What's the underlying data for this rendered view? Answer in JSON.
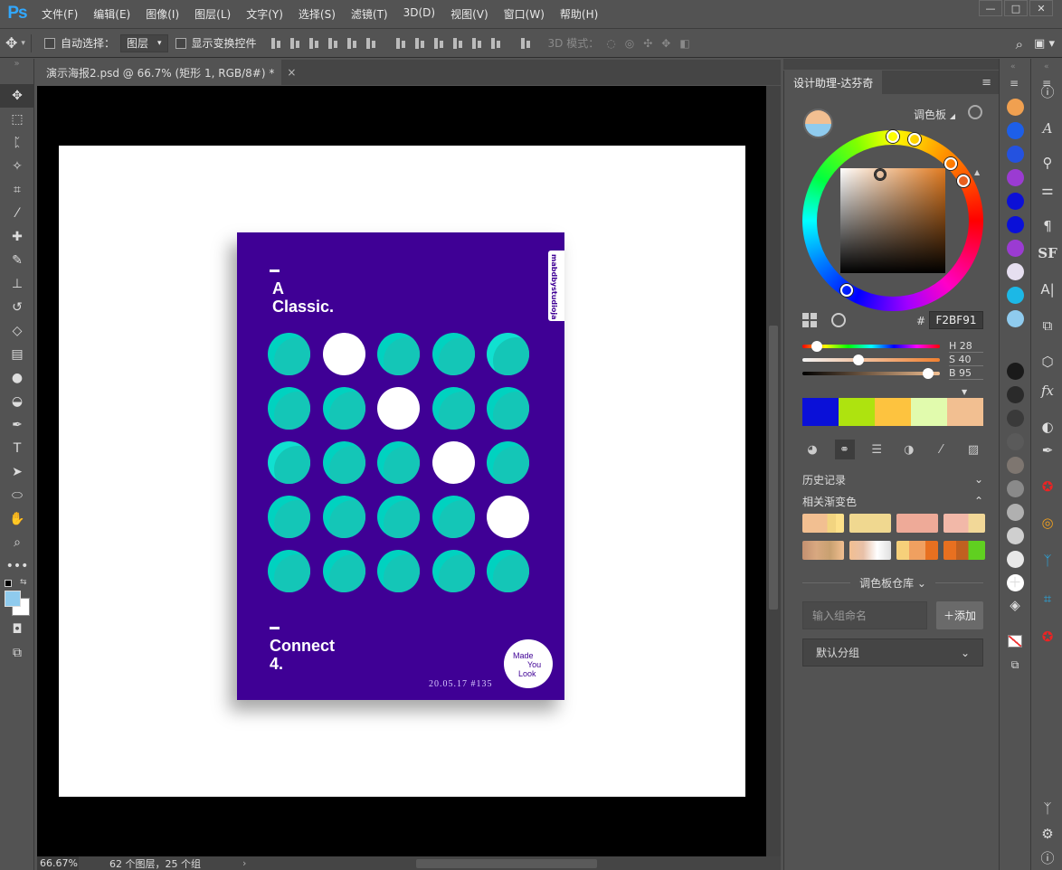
{
  "app": {
    "logo": "Ps",
    "window_controls": [
      "—",
      "□",
      "✕"
    ]
  },
  "menu": [
    "文件(F)",
    "编辑(E)",
    "图像(I)",
    "图层(L)",
    "文字(Y)",
    "选择(S)",
    "滤镜(T)",
    "3D(D)",
    "视图(V)",
    "窗口(W)",
    "帮助(H)"
  ],
  "options": {
    "auto_select_label": "自动选择：",
    "auto_select_value": "图层",
    "show_transform_label": "显示变换控件",
    "mode_3d_label": "3D 模式："
  },
  "document": {
    "tab_title": "演示海报2.psd @ 66.7% (矩形 1, RGB/8#) *",
    "close": "×"
  },
  "poster": {
    "title_line1": "A",
    "title_line2": "Classic.",
    "side_tab": "mabdbystudioja",
    "subtitle_line1": "Connect",
    "subtitle_line2": "4.",
    "date": "20.05.17   #135",
    "badge": [
      "Made",
      "You",
      "Look"
    ]
  },
  "status": {
    "zoom": "66.67%",
    "info": "62 个图层，25 个组",
    "arrow": "›"
  },
  "panel": {
    "tab": "设计助理-达芬奇",
    "palette_label": "调色板",
    "hex_hash": "#",
    "hex_value": "F2BF91",
    "h_label": "H",
    "h_value": "28",
    "s_label": "S",
    "s_value": "40",
    "b_label": "B",
    "b_value": "95",
    "colorbar": [
      "#0a10d8",
      "#aee30f",
      "#fdc33f",
      "#e1fbad",
      "#f2bf91"
    ],
    "history_label": "历史记录",
    "gradients_label": "相关渐变色",
    "library_label": "调色板仓库",
    "group_placeholder": "输入组命名",
    "add_label": "＋添加",
    "default_group": "默认分组"
  },
  "swatch_colors": [
    "#f0a050",
    "#1d5fe8",
    "#2452e0",
    "#9b3bd2",
    "#0c10d6",
    "#0a10d8",
    "#9b3bd2",
    "#e6dff0",
    "#1cb8e6",
    "#8fcbee"
  ],
  "gray_colors": [
    "#1a1a1a",
    "#2a2a2a",
    "#3a3a3a",
    "#5a5a5a",
    "#7e7670",
    "#8a8a8a",
    "#b0b0b0",
    "#cfcfcf",
    "#e8e8e8",
    "#ffffff"
  ]
}
